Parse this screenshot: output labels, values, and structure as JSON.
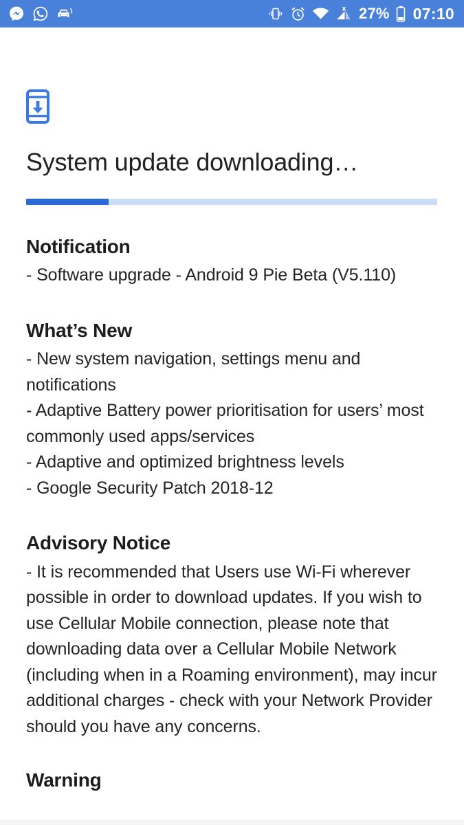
{
  "statusbar": {
    "background": "#4880da",
    "left_icons": [
      {
        "name": "messenger-icon",
        "label": "Messenger"
      },
      {
        "name": "whatsapp-icon",
        "label": "WhatsApp"
      },
      {
        "name": "car-icon",
        "label": "Car"
      }
    ],
    "right_icons": [
      {
        "name": "vibrate-icon",
        "label": "Vibrate"
      },
      {
        "name": "alarm-icon",
        "label": "Alarm"
      },
      {
        "name": "wifi-icon",
        "label": "Wi-Fi"
      },
      {
        "name": "cellular-signal-no-sim-icon",
        "label": "No SIM"
      }
    ],
    "battery_percent": "27%",
    "clock": "07:10"
  },
  "header": {
    "icon": "system-update-download-icon",
    "icon_color": "#3d7ae0",
    "title": "System update downloading…"
  },
  "progress": {
    "percent": 20,
    "fill_color": "#2a6ad8",
    "track_color": "#ccddf7"
  },
  "sections": [
    {
      "heading": "Notification",
      "lines": [
        "- Software upgrade - Android 9 Pie Beta (V5.110)"
      ]
    },
    {
      "heading": "What’s New",
      "lines": [
        "- New system navigation, settings menu and notifications",
        "- Adaptive Battery power prioritisation for users’ most commonly used apps/services",
        "- Adaptive and optimized brightness levels",
        "- Google Security Patch 2018-12"
      ]
    },
    {
      "heading": "Advisory Notice",
      "lines": [
        "- It is recommended that Users use Wi-Fi wherever possible in order to download updates. If you wish to use Cellular Mobile connection, please note that downloading data over a Cellular Mobile Network (including when in a Roaming environment), may incur additional charges - check with your Network Provider should you have any concerns."
      ]
    },
    {
      "heading": "Warning",
      "lines": []
    }
  ]
}
